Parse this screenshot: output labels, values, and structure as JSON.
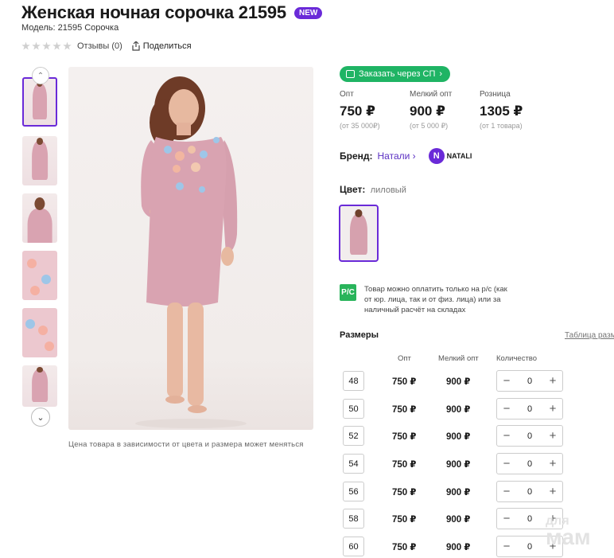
{
  "product": {
    "title": "Женская ночная сорочка 21595",
    "badge": "NEW",
    "model": "Модель: 21595 Сорочка",
    "reviews": "Отзывы (0)",
    "share": "Поделиться",
    "rating": 0,
    "rating_max": 5
  },
  "gallery": {
    "caption": "Цена товара в зависимости от цвета и размера может меняться",
    "thumbnails": [
      "model-front",
      "model-front-full",
      "model-portrait",
      "print-detail-1",
      "print-detail-2",
      "model-front-small"
    ],
    "active_index": 0
  },
  "order": {
    "sp_button": "Заказать через СП"
  },
  "prices": [
    {
      "label": "Опт",
      "value": "750 ₽",
      "note": "(от 35 000₽)"
    },
    {
      "label": "Мелкий опт",
      "value": "900 ₽",
      "note": "(от 5 000 ₽)"
    },
    {
      "label": "Розница",
      "value": "1305 ₽",
      "note": "(от 1 товара)"
    }
  ],
  "brand": {
    "label": "Бренд:",
    "name": "Натали",
    "logo_letter": "N",
    "logo_text": "NATALI"
  },
  "color": {
    "label": "Цвет:",
    "value": "лиловый"
  },
  "payment": {
    "icon_text": "Р/С",
    "text": "Товар можно оплатить только на р/с (как от юр. лица, так и от физ. лица) или за наличный расчёт на складах"
  },
  "sizes": {
    "title": "Размеры",
    "table_link": "Таблица разм",
    "headers": {
      "opt": "Опт",
      "small_opt": "Мелкий опт",
      "qty": "Количество"
    },
    "rows": [
      {
        "size": "48",
        "opt": "750 ₽",
        "small": "900 ₽",
        "qty": "0"
      },
      {
        "size": "50",
        "opt": "750 ₽",
        "small": "900 ₽",
        "qty": "0"
      },
      {
        "size": "52",
        "opt": "750 ₽",
        "small": "900 ₽",
        "qty": "0"
      },
      {
        "size": "54",
        "opt": "750 ₽",
        "small": "900 ₽",
        "qty": "0"
      },
      {
        "size": "56",
        "opt": "750 ₽",
        "small": "900 ₽",
        "qty": "0"
      },
      {
        "size": "58",
        "opt": "750 ₽",
        "small": "900 ₽",
        "qty": "0"
      },
      {
        "size": "60",
        "opt": "750 ₽",
        "small": "900 ₽",
        "qty": "0"
      }
    ]
  },
  "watermark": {
    "line1": "для",
    "line2": "мам"
  },
  "colors": {
    "accent": "#6a2ad8",
    "green": "#1fb464",
    "dress": "#d9a3b1"
  }
}
